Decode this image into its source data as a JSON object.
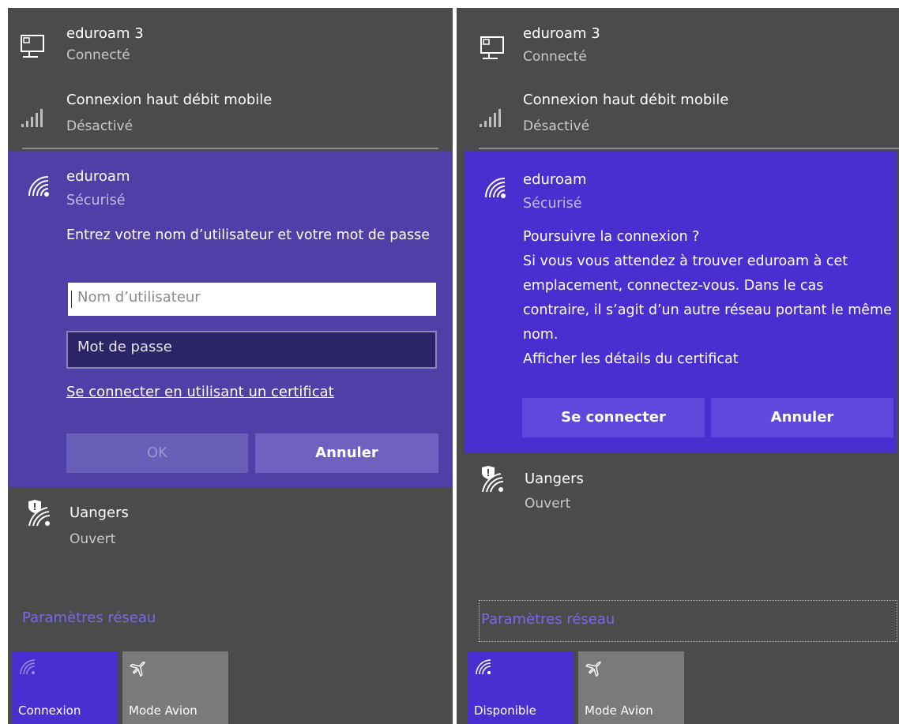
{
  "left_panel": {
    "networks_top": [
      {
        "name": "eduroam  3",
        "status": "Connecté",
        "icon": "ethernet-monitor-icon"
      },
      {
        "name": "Connexion haut débit mobile",
        "status": "Désactivé",
        "icon": "cellular-signal-icon"
      }
    ],
    "selected_network": {
      "name": "eduroam",
      "status": "Sécurisé",
      "icon": "wifi-icon",
      "prompt": "Entrez votre nom d’utilisateur et votre mot de passe",
      "username_placeholder": "Nom d’utilisateur",
      "password_placeholder": "Mot de passe",
      "certificate_link": "Se connecter en utilisant un certificat",
      "ok_label": "OK",
      "cancel_label": "Annuler"
    },
    "open_network": {
      "name": "Uangers",
      "status": "Ouvert",
      "icon": "wifi-shield-icon"
    },
    "settings_link": "Paramètres réseau",
    "tiles": [
      {
        "label": "Connexion",
        "icon": "wifi-icon",
        "active": true
      },
      {
        "label": "Mode Avion",
        "icon": "airplane-icon",
        "active": false
      }
    ]
  },
  "right_panel": {
    "networks_top": [
      {
        "name": "eduroam  3",
        "status": "Connecté",
        "icon": "ethernet-monitor-icon"
      },
      {
        "name": "Connexion haut débit mobile",
        "status": "Désactivé",
        "icon": "cellular-signal-icon"
      }
    ],
    "selected_network": {
      "name": "eduroam",
      "status": "Sécurisé",
      "icon": "wifi-icon",
      "question": "Poursuivre la connexion ?",
      "message": "Si vous vous attendez à trouver eduroam à cet emplacement, connectez-vous. Dans le cas contraire, il s’agit d’un autre réseau portant le même nom.",
      "certificate_details": "Afficher les détails du certificat",
      "connect_label": "Se connecter",
      "cancel_label": "Annuler"
    },
    "open_network": {
      "name": "Uangers",
      "status": "Ouvert",
      "icon": "wifi-shield-icon"
    },
    "settings_link": "Paramètres réseau",
    "tiles": [
      {
        "label": "Disponible",
        "icon": "wifi-icon",
        "active": true
      },
      {
        "label": "Mode Avion",
        "icon": "airplane-icon",
        "active": false
      }
    ]
  },
  "colors": {
    "panel_bg": "#4b4b4b",
    "selected_left": "#4f3fa6",
    "selected_right": "#4a2fd0",
    "accent_link": "#7869e8",
    "tile_active_left": "#4a2fd0",
    "tile_inactive": "#7a7a7a"
  }
}
